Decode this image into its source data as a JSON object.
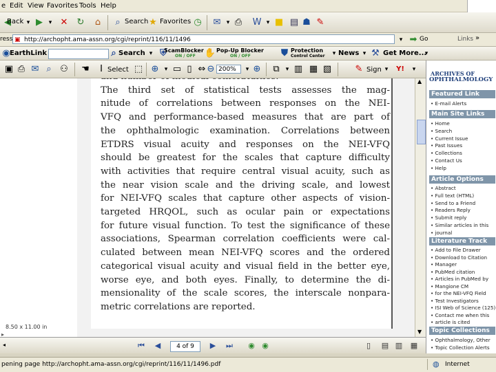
{
  "menu": {
    "items": [
      "e",
      "Edit",
      "View",
      "Favorites",
      "Tools",
      "Help"
    ]
  },
  "toolbar": {
    "back": "Back",
    "search": "Search",
    "favorites": "Favorites"
  },
  "address": {
    "left_label": "ress",
    "url": "http://archopht.ama-assn.org/cgi/reprint/116/11/1496",
    "go": "Go",
    "links": "Links"
  },
  "linksbar": {
    "earthlink": "EarthLink",
    "search": "Search",
    "scamblocker": "ScamBlocker",
    "scamblocker_state": "ON / OFF",
    "popup": "Pop-Up Blocker",
    "popup_state": "ON / OFF",
    "protection": "Protection",
    "protection_sub": "Control Center",
    "news": "News",
    "getmore": "Get More..."
  },
  "pdftoolbar": {
    "select": "Select",
    "zoom": "200%",
    "sign": "Sign"
  },
  "document": {
    "lines": [
      "and number of medical comorbidities.",
      "   The third set of statistical tests assesses the mag-",
      "nitude of correlations between responses on the NEI-",
      "VFQ and performance-based measures that are part of",
      "the ophthalmologic examination. Correlations between",
      "ETDRS visual acuity and responses on the NEI-VFQ",
      "should be greatest for the scales that capture difficulty",
      "with activities that require central visual acuity, such as",
      "the near vision scale and the driving scale, and lowest",
      "for NEI-VFQ scales that capture other aspects of vision-",
      "targeted HRQOL, such as ocular pain or expectations",
      "for future visual function. To test the significance of these",
      "associations, Spearman correlation coefficients were cal-",
      "culated between mean NEI-VFQ scores and the ordered",
      "categorical visual acuity and visual field in the better eye,",
      "worse eye, and both eyes. Finally, to determine the di-",
      "mensionality of the scale scores, the interscale nonpara-",
      "metric correlations are reported."
    ]
  },
  "sidebar": {
    "logo_line1": "ARCHIVES OF",
    "logo_line2": "OPHTHALMOLOGY",
    "featured_link": "Featured Link",
    "featured_items": [
      "E-mail Alerts"
    ],
    "main_site_links": "Main Site Links",
    "main_items": [
      "Home",
      "Search",
      "Current Issue",
      "Past Issues",
      "Collections",
      "Contact Us",
      "Help"
    ],
    "article_options": "Article Options",
    "article_items": [
      "Abstract",
      "Full text (HTML)",
      "Send to a Friend",
      "Readers Reply",
      "Submit reply",
      "Similar articles in this",
      "journal"
    ],
    "literature_track": "Literature Track",
    "literature_items": [
      "Add to File Drawer",
      "Download to Citation",
      "Manager",
      "PubMed citation",
      "Articles in PubMed by",
      "Mangione CM",
      "for the NEI-VFQ Field",
      "Test Investigators",
      "ISI Web of Science (125)",
      "Contact me when this",
      "article is cited"
    ],
    "topic_collections": "Topic Collections",
    "topic_items": [
      "Ophthalmology, Other",
      "Topic Collection Alerts"
    ]
  },
  "pdfstatus": {
    "size": "8.50 x 11.00 in",
    "page": "4 of 9"
  },
  "statusbar": {
    "text": "pening page http://archopht.ama-assn.org/cgi/reprint/116/11/1496.pdf",
    "zone": "Internet"
  },
  "colors": {
    "sidebar_header": "#7f95a9",
    "sidebar_logo": "#1f3f7a",
    "nav_blue": "#2a4e9a"
  }
}
